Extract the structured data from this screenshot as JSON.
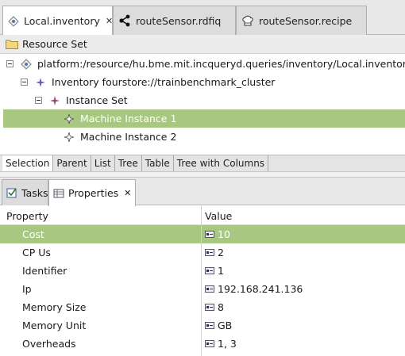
{
  "editor_tabs": [
    {
      "label": "Local.inventory",
      "icon": "inventory-model-icon",
      "active": true,
      "closable": true
    },
    {
      "label": "routeSensor.rdfiq",
      "icon": "rdfiq-graph-icon",
      "active": false,
      "closable": false
    },
    {
      "label": "routeSensor.recipe",
      "icon": "recipe-chef-icon",
      "active": false,
      "closable": false
    }
  ],
  "resource_set": {
    "header": "Resource Set",
    "tree": [
      {
        "label": "platform:/resource/hu.bme.mit.incqueryd.queries/inventory/Local.inventory",
        "level": 0,
        "expander": "collapse",
        "selected": false
      },
      {
        "label": "Inventory fourstore://trainbenchmark_cluster",
        "level": 1,
        "expander": "collapse",
        "selected": false
      },
      {
        "label": "Instance Set",
        "level": 2,
        "expander": "collapse",
        "selected": false
      },
      {
        "label": "Machine Instance 1",
        "level": 3,
        "expander": "none",
        "selected": true
      },
      {
        "label": "Machine Instance 2",
        "level": 3,
        "expander": "none",
        "selected": false
      }
    ]
  },
  "view_tabs": [
    "Selection",
    "Parent",
    "List",
    "Tree",
    "Table",
    "Tree with Columns"
  ],
  "bottom_views": [
    {
      "label": "Tasks",
      "icon": "tasks-checkbox-icon",
      "active": false
    },
    {
      "label": "Properties",
      "icon": "properties-table-icon",
      "active": true,
      "closable": true
    }
  ],
  "properties": {
    "columns": [
      "Property",
      "Value"
    ],
    "rows": [
      {
        "name": "Cost",
        "value": "10",
        "selected": true
      },
      {
        "name": "CP Us",
        "value": "2",
        "selected": false
      },
      {
        "name": "Identifier",
        "value": "1",
        "selected": false
      },
      {
        "name": "Ip",
        "value": "192.168.241.136",
        "selected": false
      },
      {
        "name": "Memory Size",
        "value": "8",
        "selected": false
      },
      {
        "name": "Memory Unit",
        "value": "GB",
        "selected": false
      },
      {
        "name": "Overheads",
        "value": "1, 3",
        "selected": false
      }
    ]
  },
  "colors": {
    "selection": "#a8c881",
    "tab_bar": "#e8e8e8"
  }
}
